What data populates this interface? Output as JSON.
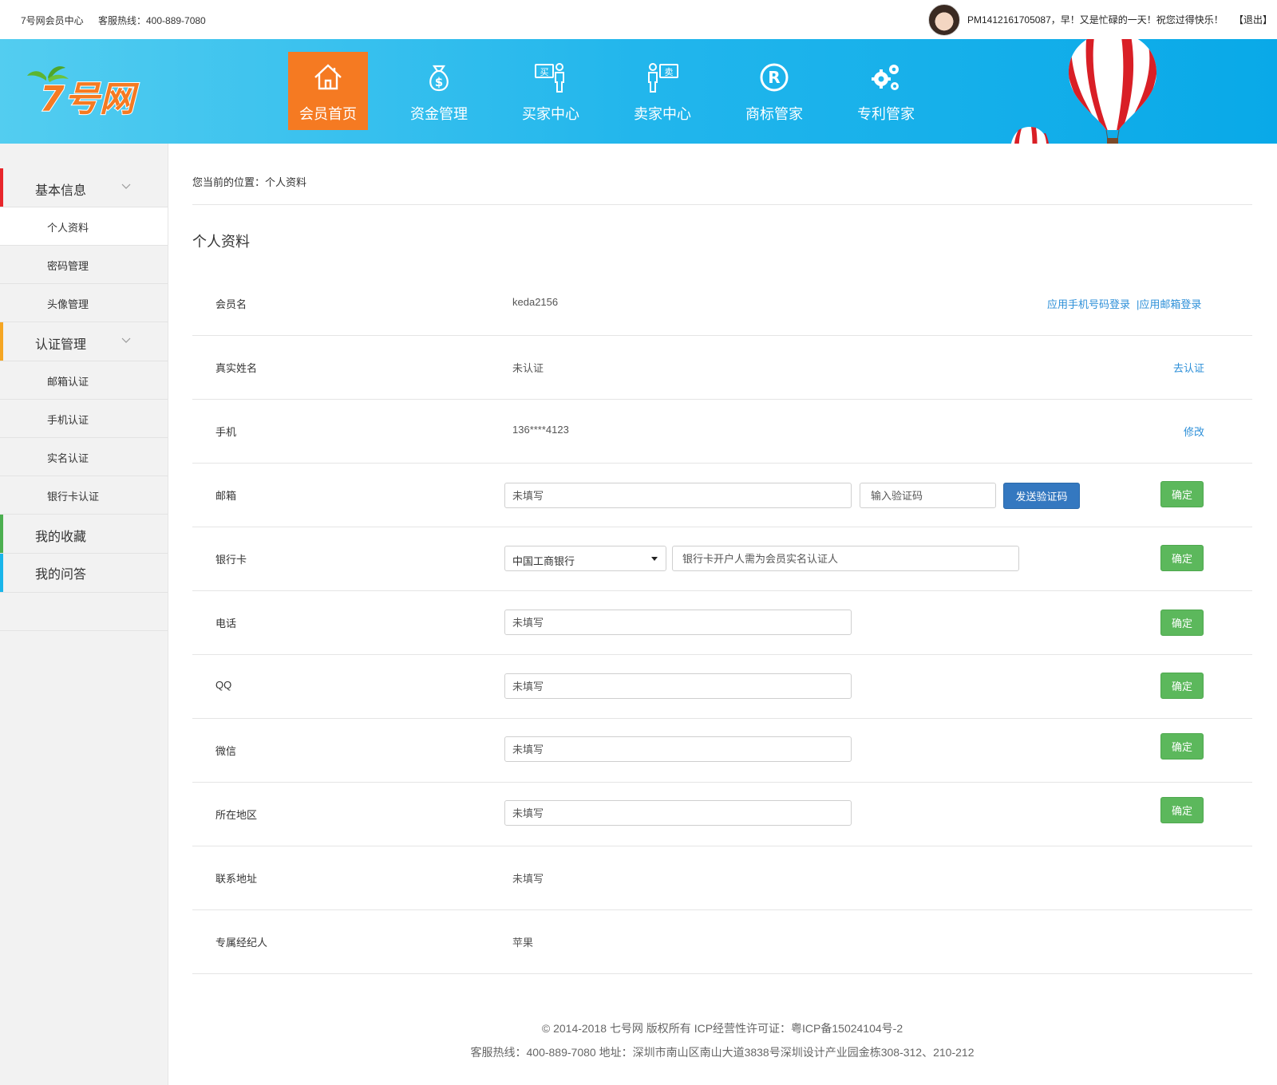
{
  "topbar": {
    "site_name": "7号网会员中心",
    "hotline": "客服热线：400-889-7080",
    "greeting": "PM1412161705087，早！又是忙碌的一天！祝您过得快乐！",
    "logout": "【退出】"
  },
  "header": {
    "logo_text": "7号网",
    "nav": [
      {
        "label": "会员首页",
        "icon": "home-icon"
      },
      {
        "label": "资金管理",
        "icon": "money-bag-icon"
      },
      {
        "label": "买家中心",
        "icon": "buyer-icon"
      },
      {
        "label": "卖家中心",
        "icon": "seller-icon"
      },
      {
        "label": "商标管家",
        "icon": "registered-trademark-icon"
      },
      {
        "label": "专利管家",
        "icon": "gears-icon"
      }
    ],
    "colors": {
      "accent": "#f57a22",
      "banner": "#22b6ec"
    }
  },
  "sidebar": {
    "groups": [
      {
        "label": "基本信息",
        "color": "#e8262b",
        "items": [
          "个人资料",
          "密码管理",
          "头像管理"
        ]
      },
      {
        "label": "认证管理",
        "color": "#f5a623",
        "items": [
          "邮箱认证",
          "手机认证",
          "实名认证",
          "银行卡认证"
        ]
      },
      {
        "label": "我的收藏",
        "color": "#4caf50",
        "items": []
      },
      {
        "label": "我的问答",
        "color": "#19b5ea",
        "items": []
      }
    ]
  },
  "main": {
    "breadcrumb": "您当前的位置：个人资料",
    "title": "个人资料",
    "rows": {
      "member": {
        "label": "会员名",
        "value": "keda2156",
        "link1": "应用手机号码登录",
        "link2": "|应用邮箱登录"
      },
      "realname": {
        "label": "真实姓名",
        "value": "未认证",
        "link": "去认证"
      },
      "phone": {
        "label": "手机",
        "value": "136****4123",
        "link": "修改"
      },
      "email": {
        "label": "邮箱",
        "placeholder": "未填写",
        "code_placeholder": "输入验证码",
        "send_btn": "发送验证码",
        "confirm": "确定"
      },
      "bank": {
        "label": "银行卡",
        "select_value": "中国工商银行",
        "placeholder": "银行卡开户人需为会员实名认证人",
        "confirm": "确定"
      },
      "tel": {
        "label": "电话",
        "placeholder": "未填写",
        "confirm": "确定"
      },
      "qq": {
        "label": "QQ",
        "placeholder": "未填写",
        "confirm": "确定"
      },
      "wechat": {
        "label": "微信",
        "placeholder": "未填写",
        "confirm": "确定"
      },
      "region": {
        "label": "所在地区",
        "placeholder": "未填写",
        "confirm": "确定"
      },
      "address": {
        "label": "联系地址",
        "value": "未填写"
      },
      "agent": {
        "label": "专属经纪人",
        "value": "苹果"
      }
    }
  },
  "footer": {
    "line1": "© 2014-2018 七号网 版权所有 ICP经营性许可证：粤ICP备15024104号-2",
    "line2": "客服热线：400-889-7080 地址：深圳市南山区南山大道3838号深圳设计产业园金栋308-312、210-212"
  }
}
